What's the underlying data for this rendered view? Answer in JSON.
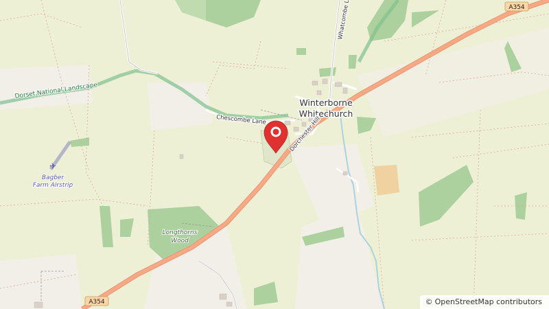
{
  "map": {
    "attribution": "OpenStreetMap contributors",
    "attribution_symbol": "©",
    "places": {
      "village_line1": "Winterborne",
      "village_line2": "Whitechurch",
      "airstrip_line1": "Bagber",
      "airstrip_line2": "Farm Airstrip",
      "wood_line1": "Longthorns",
      "wood_line2": "Wood",
      "national_landscape": "Dorset National Landscape"
    },
    "roads": {
      "a354_shield_top": "A354",
      "a354_shield_bottom": "A354",
      "chescombe_lane": "Chescombe Lane",
      "dorchester_hill": "Dorchester Hill",
      "whatcombe_lane": "Whatcombe La"
    },
    "marker": {
      "icon": "location-pin-icon",
      "color": "#e03030"
    },
    "colors": {
      "farmland": "#eef0d5",
      "wood": "#add19e",
      "primary_road": "#fcd6a4",
      "primary_road_casing": "#e9967a",
      "park_boundary": "#4fa16b",
      "water": "#aad3df"
    }
  }
}
